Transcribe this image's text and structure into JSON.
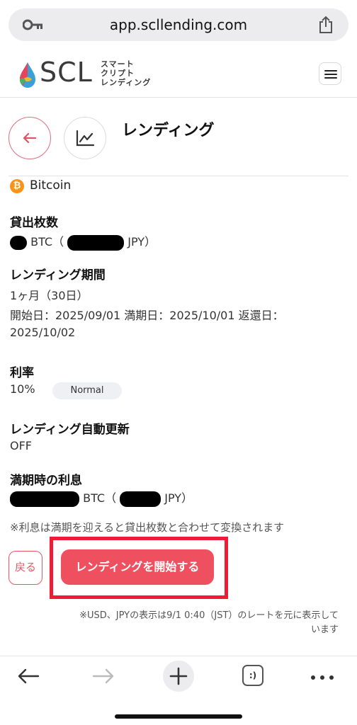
{
  "browser": {
    "url": "app.scllending.com"
  },
  "header": {
    "logo_text": "SCL",
    "logo_sub_line1": "スマート",
    "logo_sub_line2": "クリプト",
    "logo_sub_line3": "レンディング",
    "menu_icon": "hamburger-icon"
  },
  "page": {
    "title": "レンディング",
    "back_icon": "arrow-left-icon",
    "chart_icon": "line-chart-icon"
  },
  "asset": {
    "coin_symbol": "₿",
    "coin_name": "Bitcoin"
  },
  "lend_amount": {
    "label": "貸出枚数",
    "unit_btc": "BTC（",
    "unit_jpy": "JPY）"
  },
  "period": {
    "label": "レンディング期間",
    "duration": "1ヶ月（30日）",
    "dates_line1": "開始日：2025/09/01 満期日：2025/10/01 返還日：",
    "dates_line2": "2025/10/02"
  },
  "rate": {
    "label": "利率",
    "value": "10%",
    "badge": "Normal"
  },
  "auto_renew": {
    "label": "レンディング自動更新",
    "value": "OFF"
  },
  "interest": {
    "label": "満期時の利息",
    "unit_btc": "BTC（",
    "unit_jpy": "JPY）"
  },
  "notes": {
    "conversion_note": "※利息は満期を迎えると貸出枚数と合わせて変換されます",
    "footnote_line1": "※USD、JPYの表示は9/1 0:40（JST）のレートを元に表示して",
    "footnote_line2": "います"
  },
  "actions": {
    "back_label": "戻る",
    "start_label": "レンディングを開始する"
  },
  "toolbar": {
    "tabs_label": ":)"
  },
  "colors": {
    "accent": "#ee5060",
    "highlight": "#ee1c35",
    "bitcoin": "#f7931a"
  }
}
